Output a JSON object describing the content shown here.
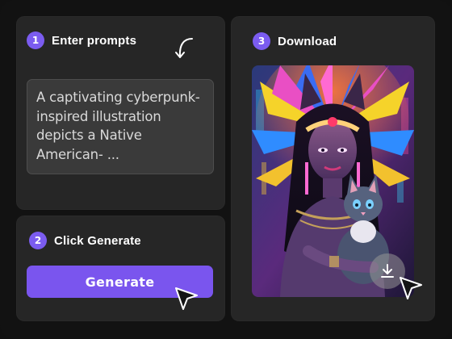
{
  "steps": {
    "prompt": {
      "number": "1",
      "title": "Enter prompts",
      "text": "A captivating cyberpunk-inspired illustration depicts a Native American- ..."
    },
    "generate": {
      "number": "2",
      "title": "Click Generate",
      "button_label": "Generate"
    },
    "download": {
      "number": "3",
      "title": "Download"
    }
  },
  "colors": {
    "accent": "#7a55ee",
    "card": "#262626",
    "background": "#121212"
  },
  "icons": {
    "curl": "curved-arrow-icon",
    "cursor": "cursor-pointer-icon",
    "download": "download-icon"
  }
}
